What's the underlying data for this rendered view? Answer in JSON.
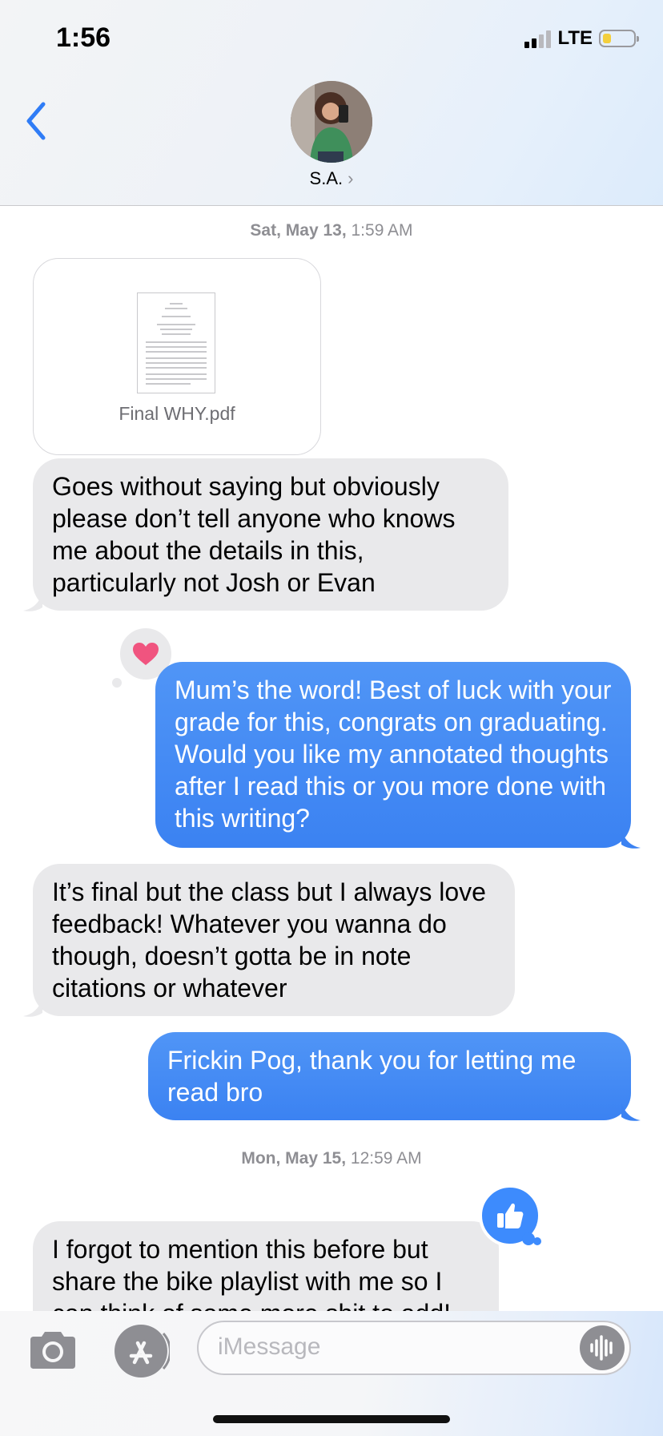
{
  "status": {
    "time": "1:56",
    "network": "LTE",
    "battery_level": 0.25,
    "signal_bars": 2
  },
  "header": {
    "contact_name": "S.A.",
    "chevron": "›"
  },
  "timestamps": [
    {
      "day": "Sat, May 13,",
      "time": "1:59 AM"
    },
    {
      "day": "Mon, May 15,",
      "time": "12:59 AM"
    }
  ],
  "attachment": {
    "file_name": "Final WHY.pdf"
  },
  "messages": [
    {
      "from": "them",
      "text": "Goes without saying but obviously please don’t tell anyone who knows me about the details in this, particularly not Josh or Evan"
    },
    {
      "from": "me",
      "text": "Mum’s the word! Best of luck with your grade for this, congrats on graduating. Would you like my annotated thoughts after I read this or you more done with this writing?",
      "reaction": "heart"
    },
    {
      "from": "them",
      "text": "It’s final but the class but I always love feedback! Whatever you wanna do though, doesn’t gotta be in note citations or whatever"
    },
    {
      "from": "me",
      "text": "Frickin Pog, thank you for letting me read bro"
    },
    {
      "from": "them",
      "text": "I forgot to mention this before but share the bike playlist with me so I can think of some more shit to add!",
      "reaction": "thumbs-up"
    }
  ],
  "input": {
    "placeholder": "iMessage"
  },
  "colors": {
    "sent_bubble": "#3b82f2",
    "received_bubble": "#e9e9eb",
    "accent": "#2f7cf6",
    "heart": "#f0547f"
  },
  "icons": [
    "back-icon",
    "camera-icon",
    "app-store-icon",
    "audio-waveform-icon",
    "heart-icon",
    "thumbs-up-icon"
  ]
}
